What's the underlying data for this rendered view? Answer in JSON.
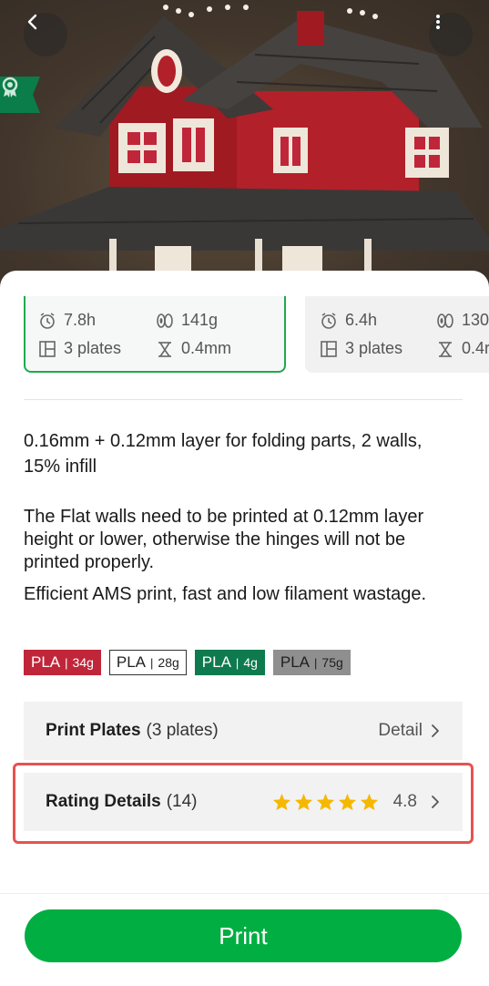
{
  "header": {
    "back_icon": "chevron-left-icon",
    "more_icon": "more-vertical-icon",
    "badge_icon": "award-ribbon-icon"
  },
  "profiles": [
    {
      "selected": true,
      "time": "7.8h",
      "weight": "141g",
      "plates": "3 plates",
      "nozzle": "0.4mm"
    },
    {
      "selected": false,
      "time": "6.4h",
      "weight": "130",
      "plates": "3 plates",
      "nozzle": "0.4r"
    }
  ],
  "profile_title": "0.16mm + 0.12mm layer for folding parts, 2 walls, 15% infill",
  "description_1": "The Flat walls need to be printed at 0.12mm layer height or lower, otherwise the hinges will not be printed properly.",
  "description_2": "Efficient AMS print, fast and low filament wastage.",
  "filaments": [
    {
      "type": "PLA",
      "weight": "34g",
      "bg": "#c0263a",
      "fg": "#ffffff",
      "border": "#c0263a"
    },
    {
      "type": "PLA",
      "weight": "28g",
      "bg": "#ffffff",
      "fg": "#222222",
      "border": "#333333"
    },
    {
      "type": "PLA",
      "weight": "4g",
      "bg": "#0e7a4e",
      "fg": "#ffffff",
      "border": "#0e7a4e"
    },
    {
      "type": "PLA",
      "weight": "75g",
      "bg": "#8f8f8f",
      "fg": "#1f1f1f",
      "border": "#8f8f8f"
    }
  ],
  "print_plates": {
    "label": "Print Plates",
    "count": "(3 plates)",
    "action": "Detail"
  },
  "rating": {
    "label": "Rating Details",
    "count": "(14)",
    "value": "4.8",
    "stars": 5,
    "star_color": "#f5b800"
  },
  "print_button": "Print",
  "colors": {
    "accent": "#00ae42",
    "highlight": "#e8524f"
  }
}
